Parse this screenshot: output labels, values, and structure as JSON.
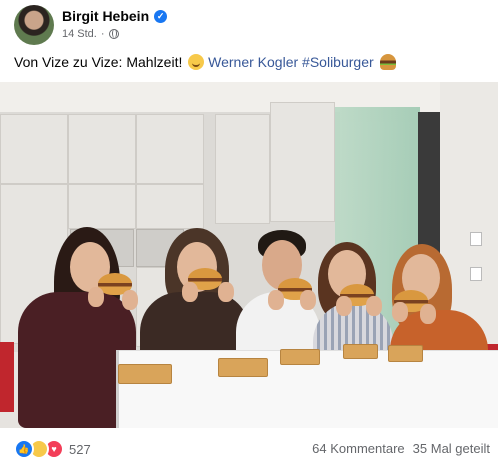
{
  "post": {
    "author": "Birgit Hebein",
    "time": "14 Std.",
    "text_main": "Von Vize zu Vize: Mahlzeit!",
    "mention": "Werner Kogler",
    "hashtag": "#Soliburger"
  },
  "icons": {
    "verified": "verified-badge-icon",
    "privacy": "globe-icon",
    "emoji_1": "smiling-face-icon",
    "emoji_2": "burger-icon",
    "reactions": [
      "like-icon",
      "haha-icon",
      "love-icon"
    ]
  },
  "footer": {
    "reaction_count": "527",
    "comments": "64 Kommentare",
    "shares": "35 Mal geteilt"
  },
  "colors": {
    "link": "#385898",
    "verified": "#1877f2",
    "like": "#1877f2",
    "love": "#f33e58",
    "haha": "#f7c94a",
    "meta": "#65676b"
  }
}
